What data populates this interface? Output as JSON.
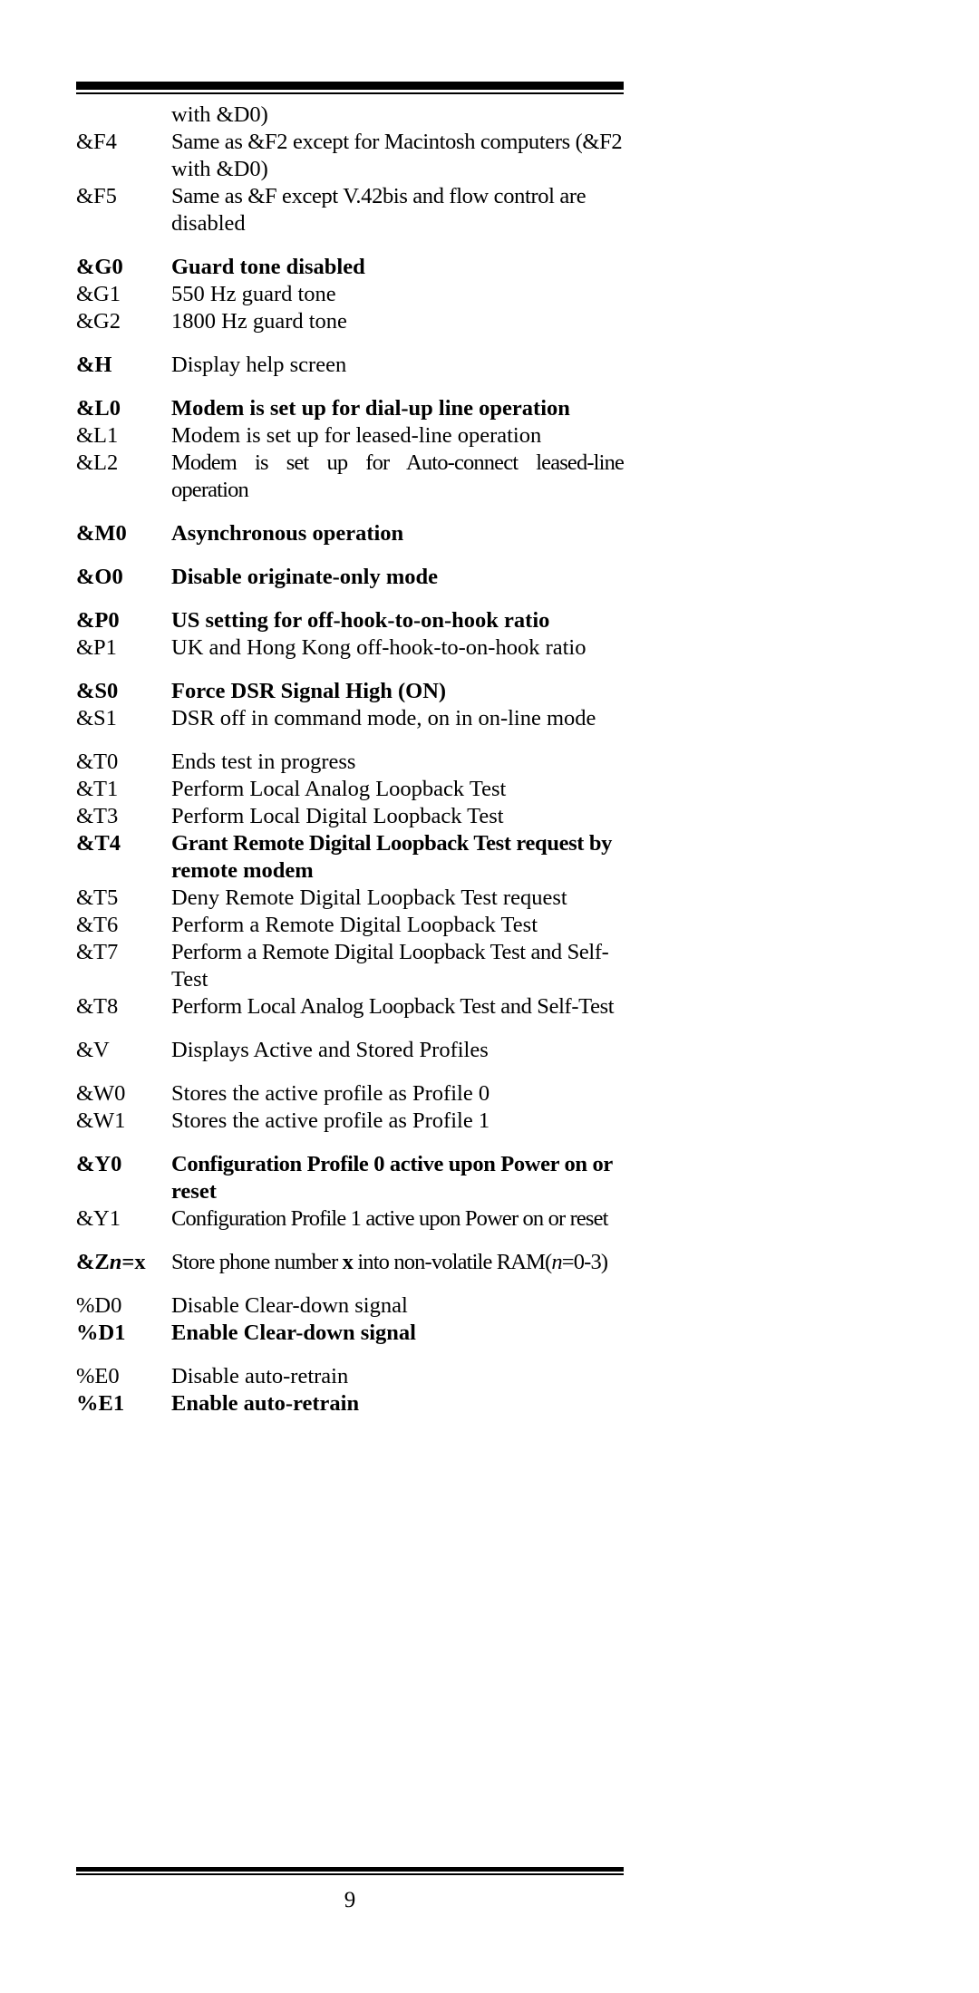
{
  "document": {
    "page_number": "9",
    "type": "modem-at-command-reference"
  },
  "rows": [
    {
      "code": "",
      "desc": "with &D0)",
      "bold": false,
      "continuation": true
    },
    {
      "code": "&F4",
      "desc": "Same as &F2 except for Macintosh computers (&F2",
      "bold": false,
      "gap": false,
      "justify": true
    },
    {
      "code": "",
      "desc": "with &D0)",
      "bold": false,
      "continuation": true
    },
    {
      "code": "&F5",
      "desc": "Same as &F except V.42bis and flow control are",
      "bold": false,
      "gap": false,
      "justify": true
    },
    {
      "code": "",
      "desc": "disabled",
      "bold": false,
      "continuation": true
    },
    {
      "code": "&G0",
      "desc": "Guard tone disabled",
      "bold": true,
      "gap": true
    },
    {
      "code": "&G1",
      "desc": "550 Hz guard tone",
      "bold": false,
      "gap": false
    },
    {
      "code": "&G2",
      "desc": "1800 Hz guard tone",
      "bold": false,
      "gap": false
    },
    {
      "code": "&H",
      "desc": "Display help screen",
      "bold": true,
      "gap": true,
      "desc_bold": false
    },
    {
      "code": "&L0",
      "desc": "Modem is set up for dial-up line operation",
      "bold": true,
      "gap": true
    },
    {
      "code": "&L1",
      "desc": "Modem is set up for leased-line operation",
      "bold": false,
      "gap": false
    },
    {
      "code": "&L2",
      "desc": "Modem is set up for Auto-connect leased-line operation",
      "bold": false,
      "gap": false
    },
    {
      "code": "&M0",
      "desc": "Asynchronous operation",
      "bold": true,
      "gap": true
    },
    {
      "code": "&O0",
      "desc": "Disable originate-only mode",
      "bold": true,
      "gap": true
    },
    {
      "code": "&P0",
      "desc": "US setting for off-hook-to-on-hook ratio",
      "bold": true,
      "gap": true
    },
    {
      "code": "&P1",
      "desc": "UK and Hong Kong off-hook-to-on-hook ratio",
      "bold": false,
      "gap": false
    },
    {
      "code": "&S0",
      "desc": "Force DSR Signal High (ON)",
      "bold": true,
      "gap": true
    },
    {
      "code": "&S1",
      "desc": "DSR off in command mode, on in on-line mode",
      "bold": false,
      "gap": false
    },
    {
      "code": "&T0",
      "desc": "Ends test in progress",
      "bold": false,
      "gap": true
    },
    {
      "code": "&T1",
      "desc": "Perform Local Analog Loopback Test",
      "bold": false,
      "gap": false
    },
    {
      "code": "&T3",
      "desc": "Perform Local Digital Loopback Test",
      "bold": false,
      "gap": false
    },
    {
      "code": "&T4",
      "desc": "Grant Remote Digital Loopback Test request by",
      "bold": true,
      "gap": false,
      "justify": true
    },
    {
      "code": "",
      "desc": "remote modem",
      "bold": true,
      "continuation": true
    },
    {
      "code": "&T5",
      "desc": "Deny Remote Digital Loopback Test request",
      "bold": false,
      "gap": false
    },
    {
      "code": "&T6",
      "desc": "Perform a Remote Digital Loopback Test",
      "bold": false,
      "gap": false
    },
    {
      "code": "&T7",
      "desc": "Perform a Remote Digital Loopback Test and Self-",
      "bold": false,
      "gap": false,
      "justify": true
    },
    {
      "code": "",
      "desc": "Test",
      "bold": false,
      "continuation": true
    },
    {
      "code": "&T8",
      "desc": "Perform Local Analog Loopback Test and Self-Test",
      "bold": false,
      "gap": false
    },
    {
      "code": "&V",
      "desc": "Displays Active and Stored Profiles",
      "bold": false,
      "gap": true
    },
    {
      "code": "&W0",
      "desc": "Stores the active profile as Profile 0",
      "bold": false,
      "gap": true
    },
    {
      "code": "&W1",
      "desc": "Stores the active profile as Profile 1",
      "bold": false,
      "gap": false
    },
    {
      "code": "&Y0",
      "desc": "Configuration Profile 0 active upon Power on or",
      "bold": true,
      "gap": true,
      "justify": true
    },
    {
      "code": "",
      "desc": "reset",
      "bold": true,
      "continuation": true
    },
    {
      "code": "&Y1",
      "desc": "Configuration Profile 1 active upon Power on or reset",
      "bold": false,
      "gap": false
    },
    {
      "code": "&Zn=x",
      "desc": "Store phone number x into non-volatile RAM(n=0-3)",
      "bold": true,
      "gap": true,
      "desc_bold": false,
      "rich": "zn"
    },
    {
      "code": "%D0",
      "desc": "Disable Clear-down signal",
      "bold": false,
      "gap": true
    },
    {
      "code": "%D1",
      "desc": "Enable Clear-down signal",
      "bold": true,
      "gap": false
    },
    {
      "code": "%E0",
      "desc": "Disable auto-retrain",
      "bold": false,
      "gap": true
    },
    {
      "code": "%E1",
      "desc": "Enable auto-retrain",
      "bold": true,
      "gap": false
    }
  ]
}
